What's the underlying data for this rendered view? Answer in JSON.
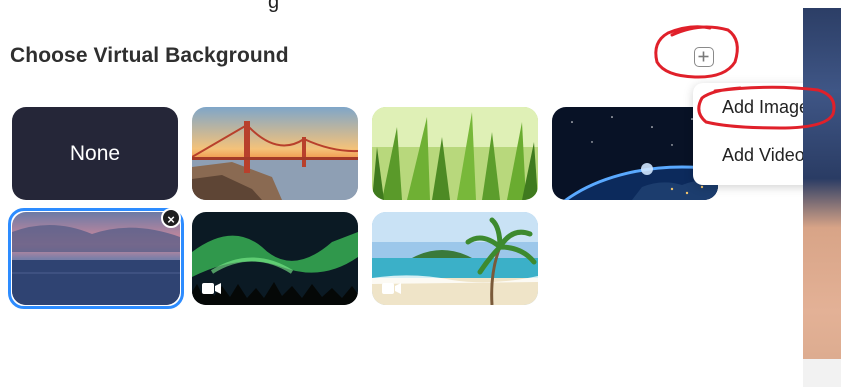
{
  "top_crop_text": "g",
  "title": "Choose Virtual Background",
  "menu": {
    "items": [
      {
        "label": "Add Image"
      },
      {
        "label": "Add Video"
      }
    ]
  },
  "backgrounds": [
    {
      "label": "None"
    },
    {
      "icon": "golden-gate-image"
    },
    {
      "icon": "grass-image"
    },
    {
      "icon": "earth-space-image"
    },
    {
      "icon": "sunset-sea-image",
      "selected": true
    },
    {
      "icon": "aurora-video",
      "video": true
    },
    {
      "icon": "beach-video",
      "video": true
    }
  ],
  "colors": {
    "accent": "#2d8cff",
    "none_tile": "#252638",
    "annotation": "#e0202a"
  }
}
